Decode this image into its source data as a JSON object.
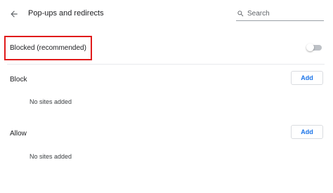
{
  "header": {
    "back_icon": "arrow-left-icon",
    "title": "Pop-ups and redirects",
    "search": {
      "icon": "search-icon",
      "placeholder": "Search"
    }
  },
  "blocked": {
    "label": "Blocked (recommended)",
    "toggle_on": false,
    "highlight_color": "#e01b1b"
  },
  "block_section": {
    "label": "Block",
    "add_label": "Add",
    "empty_text": "No sites added"
  },
  "allow_section": {
    "label": "Allow",
    "add_label": "Add",
    "empty_text": "No sites added"
  },
  "colors": {
    "accent": "#1a73e8",
    "toggle_off_track": "#bdc1c6"
  }
}
